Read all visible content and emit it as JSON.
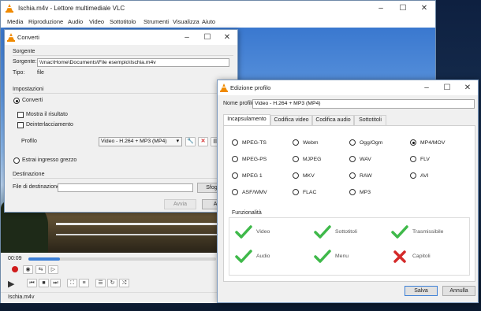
{
  "vlc": {
    "title": "Ischia.m4v - Lettore multimediale VLC",
    "menu": [
      "Media",
      "Riproduzione",
      "Audio",
      "Video",
      "Sottotitolo",
      "Strumenti",
      "Visualizza",
      "Aiuto"
    ],
    "time": "00:09",
    "progress_fraction": 0.17,
    "status_file": "Ischia.m4v"
  },
  "convert": {
    "title": "Converti",
    "source_section": "Sorgente",
    "source_label": "Sorgente:",
    "source_value": "\\\\mac\\Home\\Documents\\File esempio\\Ischia.m4v",
    "type_label": "Tipo:",
    "type_value": "file",
    "settings_section": "Impostazioni",
    "convert_option": "Converti",
    "show_output": "Mostra il risultato",
    "deinterlace": "Deinterlacciamento",
    "profile_label": "Profilo",
    "profile_value": "Video - H.264 + MP3 (MP4)",
    "raw_option": "Estrai ingresso grezzo",
    "dest_section": "Destinazione",
    "dest_label": "File di destinazione:",
    "browse_label": "Sfogli",
    "start_label": "Avvia",
    "cancel_label": "Ann"
  },
  "profile": {
    "title": "Edizione profilo",
    "name_label": "Nome profilo",
    "name_value": "Video - H.264 + MP3 (MP4)",
    "tabs": [
      "Incapsulamento",
      "Codifica video",
      "Codifica audio",
      "Sottotitoli"
    ],
    "active_tab": "Incapsulamento",
    "options": [
      "MPEG-TS",
      "Webm",
      "Ogg/Ogm",
      "MP4/MOV",
      "MPEG-PS",
      "MJPEG",
      "WAV",
      "FLV",
      "MPEG 1",
      "MKV",
      "RAW",
      "AVI",
      "ASF/WMV",
      "FLAC",
      "MP3"
    ],
    "selected_option": "MP4/MOV",
    "features_title": "Funzionalità",
    "features": [
      {
        "label": "Video",
        "supported": true
      },
      {
        "label": "Sottotitoli",
        "supported": true
      },
      {
        "label": "Trasmissibile",
        "supported": true
      },
      {
        "label": "Audio",
        "supported": true
      },
      {
        "label": "Menu",
        "supported": true
      },
      {
        "label": "Capitoli",
        "supported": false
      }
    ],
    "save_label": "Salva",
    "cancel_label": "Annulla"
  },
  "colors": {
    "check_green": "#3fb94a",
    "cross_red": "#d42a2a",
    "vlc_orange": "#f08a00",
    "progress_blue": "#3c7fd6",
    "record_red": "#d01c1c"
  },
  "icons": {
    "vlc": "vlc-cone-icon",
    "minimize": "minimize-icon",
    "maximize": "maximize-icon",
    "close": "close-icon"
  }
}
